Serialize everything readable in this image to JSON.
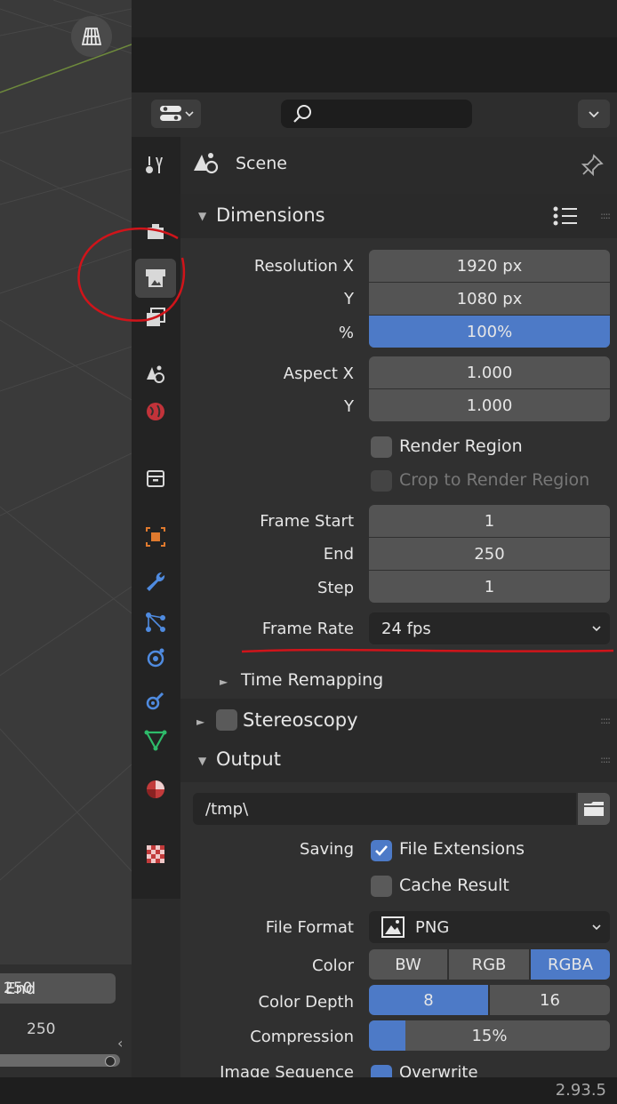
{
  "header": {
    "search_placeholder": ""
  },
  "scene": {
    "label": "Scene"
  },
  "dimensions": {
    "title": "Dimensions",
    "resolution_x_label": "Resolution X",
    "resolution_x": "1920 px",
    "y_label": "Y",
    "resolution_y": "1080 px",
    "percent_label": "%",
    "percent": "100%",
    "percent_value": 1.0,
    "aspect_x_label": "Aspect X",
    "aspect_x": "1.000",
    "aspect_y_label": "Y",
    "aspect_y": "1.000",
    "render_region_label": "Render Region",
    "crop_label": "Crop to Render Region",
    "frame_start_label": "Frame Start",
    "frame_start": "1",
    "end_label": "End",
    "frame_end": "250",
    "step_label": "Step",
    "frame_step": "1",
    "frame_rate_label": "Frame Rate",
    "frame_rate": "24 fps",
    "time_remapping_label": "Time Remapping"
  },
  "stereoscopy": {
    "title": "Stereoscopy"
  },
  "output": {
    "title": "Output",
    "path": "/tmp\\",
    "saving_label": "Saving",
    "file_extensions_label": "File Extensions",
    "cache_result_label": "Cache Result",
    "file_format_label": "File Format",
    "file_format": "PNG",
    "color_label": "Color",
    "color_options": [
      "BW",
      "RGB",
      "RGBA"
    ],
    "color_selected": "RGBA",
    "color_depth_label": "Color Depth",
    "color_depth_options": [
      "8",
      "16"
    ],
    "color_depth_selected": "8",
    "compression_label": "Compression",
    "compression": "15%",
    "compression_value": 0.15,
    "image_sequence_label": "Image Sequence",
    "overwrite_label": "Overwrite"
  },
  "timeline": {
    "end_label": "End",
    "end_value": "250",
    "current_value": "250"
  },
  "status": {
    "version": "2.93.5"
  },
  "colors": {
    "accent": "#4d7ac7",
    "annotation": "#d0141a"
  }
}
